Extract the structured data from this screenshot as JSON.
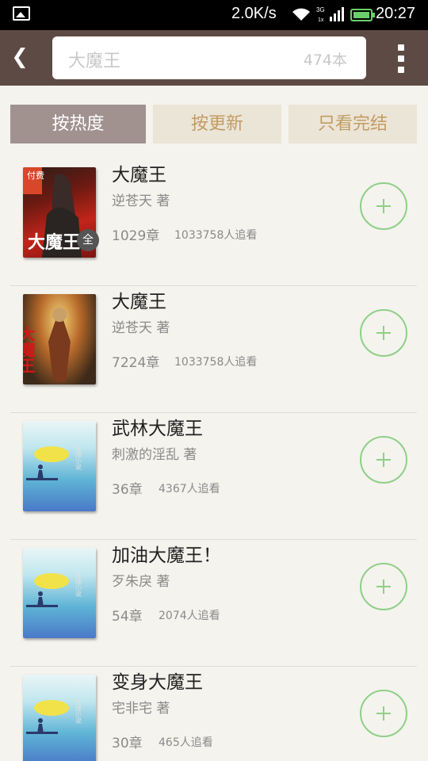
{
  "status_bar": {
    "speed": "2.0K/s",
    "time": "20:27",
    "network": "3G"
  },
  "header": {
    "search_query": "大魔王",
    "result_count": "474本"
  },
  "tabs": [
    {
      "label": "按热度",
      "selected": true
    },
    {
      "label": "按更新",
      "selected": false
    },
    {
      "label": "只看完结",
      "selected": false
    }
  ],
  "books": [
    {
      "title": "大魔王",
      "author": "逆苍天 著",
      "chapters": "1029章",
      "followers": "1033758人追看",
      "badge": "全",
      "cover_label": "付费",
      "cover_title": "大魔王"
    },
    {
      "title": "大魔王",
      "author": "逆苍天 著",
      "chapters": "7224章",
      "followers": "1033758人追看",
      "cover_title": "大魔王"
    },
    {
      "title": "武林大魔王",
      "author": "刺激的淫乱 著",
      "chapters": "36章",
      "followers": "4367人追看",
      "cover_title": "宜搜小说"
    },
    {
      "title": "加油大魔王！",
      "author": "歹朱戾 著",
      "chapters": "54章",
      "followers": "2074人追看",
      "cover_title": "宜搜小说"
    },
    {
      "title": "变身大魔王",
      "author": "宅非宅 著",
      "chapters": "30章",
      "followers": "465人追看",
      "cover_title": "宜搜小说"
    }
  ],
  "colors": {
    "header_bg": "#5e4a44",
    "tab_selected": "#a19290",
    "tab_idle": "#ebe5d7",
    "accent_green": "#8fcf87",
    "tab_text": "#c29c63"
  }
}
